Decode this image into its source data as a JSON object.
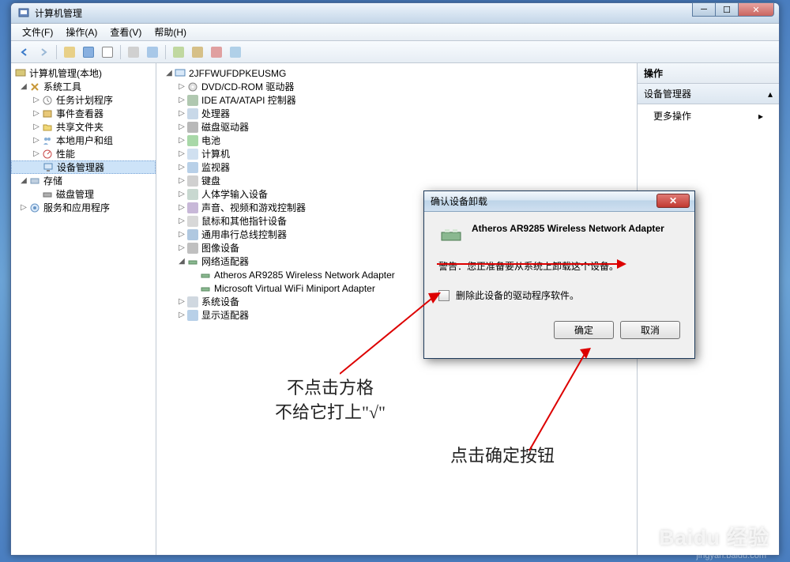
{
  "window": {
    "title": "计算机管理"
  },
  "menu": {
    "file": "文件(F)",
    "action": "操作(A)",
    "view": "查看(V)",
    "help": "帮助(H)"
  },
  "leftTree": {
    "root": "计算机管理(本地)",
    "systemTools": "系统工具",
    "taskScheduler": "任务计划程序",
    "eventViewer": "事件查看器",
    "sharedFolders": "共享文件夹",
    "localUsers": "本地用户和组",
    "performance": "性能",
    "deviceManager": "设备管理器",
    "storage": "存储",
    "diskManagement": "磁盘管理",
    "services": "服务和应用程序"
  },
  "centerTree": {
    "root": "2JFFWUFDPKEUSMG",
    "dvd": "DVD/CD-ROM 驱动器",
    "ide": "IDE ATA/ATAPI 控制器",
    "processor": "处理器",
    "diskDrive": "磁盘驱动器",
    "battery": "电池",
    "computer": "计算机",
    "monitor": "监视器",
    "keyboard": "键盘",
    "hid": "人体学输入设备",
    "sound": "声音、视频和游戏控制器",
    "mouse": "鼠标和其他指针设备",
    "usb": "通用串行总线控制器",
    "imaging": "图像设备",
    "network": "网络适配器",
    "netAdapter1": "Atheros AR9285 Wireless Network Adapter",
    "netAdapter2": "Microsoft Virtual WiFi Miniport Adapter",
    "systemDevices": "系统设备",
    "displayAdapters": "显示适配器"
  },
  "rightPane": {
    "header": "操作",
    "section": "设备管理器",
    "moreActions": "更多操作"
  },
  "dialog": {
    "title": "确认设备卸载",
    "deviceName": "Atheros AR9285 Wireless Network Adapter",
    "warning": "警告：您正准备要从系统上卸载这个设备。",
    "checkboxLabel": "删除此设备的驱动程序软件。",
    "ok": "确定",
    "cancel": "取消"
  },
  "annotations": {
    "line1": "不点击方格",
    "line2": "不给它打上\"√\"",
    "line3": "点击确定按钮"
  },
  "watermark": {
    "main": "Baidu 经验",
    "sub": "jingyan.baidu.com"
  }
}
